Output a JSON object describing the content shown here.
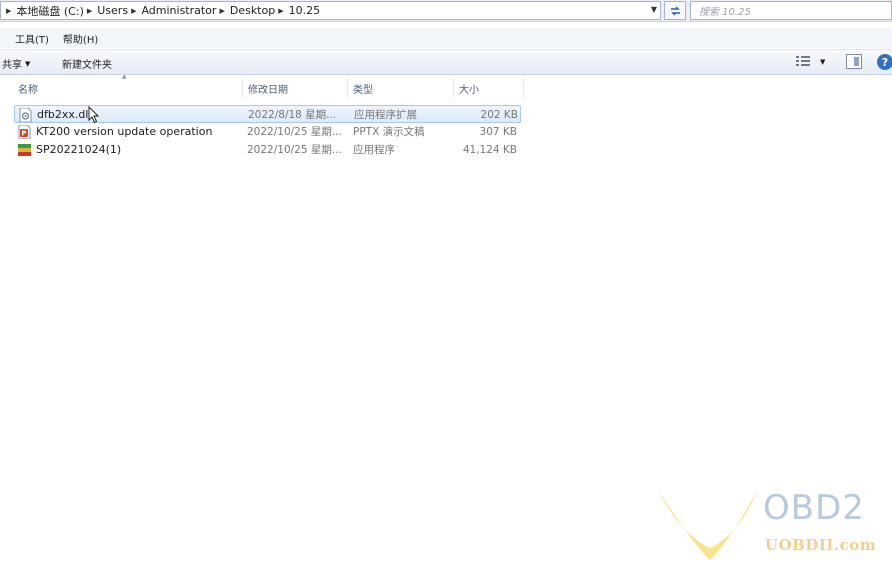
{
  "address": {
    "breadcrumbs": [
      "本地磁盘 (C:)",
      "Users",
      "Administrator",
      "Desktop",
      "10.25"
    ],
    "search_placeholder": "搜索 10.25"
  },
  "menu": {
    "items": [
      "工具(T)",
      "帮助(H)"
    ]
  },
  "toolbar": {
    "share_label": "共享",
    "new_folder_label": "新建文件夹"
  },
  "columns": {
    "name": "名称",
    "date": "修改日期",
    "type": "类型",
    "size": "大小"
  },
  "files": [
    {
      "name": "dfb2xx.dll",
      "date": "2022/8/18 星期...",
      "type": "应用程序扩展",
      "size": "202 KB",
      "icon": "dll-file-icon",
      "selected": true
    },
    {
      "name": "KT200 version update operation",
      "date": "2022/10/25 星期...",
      "type": "PPTX 演示文稿",
      "size": "307 KB",
      "icon": "pptx-file-icon",
      "selected": false
    },
    {
      "name": "SP20221024(1)",
      "date": "2022/10/25 星期...",
      "type": "应用程序",
      "size": "41,124 KB",
      "icon": "exe-app-icon",
      "selected": false
    }
  ],
  "watermark": {
    "brand": "OBD2",
    "site": "UOBDII.com",
    "colors": {
      "brand": "#b9c9dd",
      "site": "#f1cf8f",
      "swoosh": "#f6e07a"
    }
  }
}
